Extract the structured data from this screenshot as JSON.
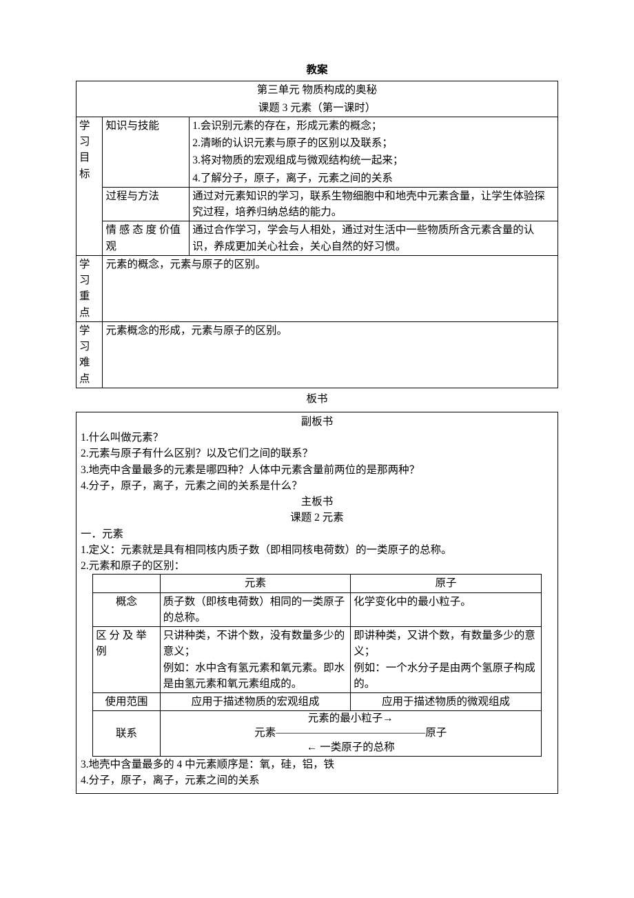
{
  "page_title": "教案",
  "unit_title": "第三单元   物质构成的奥秘",
  "lesson_title": "课题 3 元素（第一课时）",
  "objectives": {
    "row_label": "学 习 目 标",
    "knowledge": {
      "label": "知识与技能",
      "l1": "1.会识别元素的存在，形成元素的概念；",
      "l2": "2.清晰的认识元素与原子的区别以及联系；",
      "l3": "3.将对物质的宏观组成与微观结构统一起来；",
      "l4": "4.了解分子，原子，离子，元素之间的关系"
    },
    "process": {
      "label": "过程与方法",
      "text": "通过对元素知识的学习，联系生物细胞中和地壳中元素含量，让学生体验探究过程，培养归纳总结的能力。"
    },
    "attitude": {
      "label": "情 感 态 度 价值观",
      "text": "通过合作学习，学会与人相处，通过对生活中一些物质所含元素含量的认识，养成更加关心社会，关心自然的好习惯。"
    }
  },
  "keypoint": {
    "label": "学 习 重 点",
    "text": "元素的概念，元素与原子的区别。"
  },
  "difficulty": {
    "label": "学 习 难 点",
    "text": "元素概念的形成，元素与原子的区别。"
  },
  "board": {
    "heading": "板书",
    "sub_heading": "副板书",
    "q1": "1.什么叫做元素？",
    "q2": "2.元素与原子有什么区别？以及它们之间的联系？",
    "q3": "3.地壳中含量最多的元素是哪四种？人体中元素含量前两位的是那两种？",
    "q4": "4.分子，原子，离子，元素之间的关系是什么？",
    "main_heading": "主板书",
    "main_topic": "课题 2 元素",
    "sec1": "一．元素",
    "def": "1.定义：元素就是具有相同核内质子数（即相同核电荷数）的一类原子的总称。",
    "diff_label": "2.元素和原子的区别：",
    "table": {
      "h_element": "元素",
      "h_atom": "原子",
      "r_concept": "概念",
      "r_concept_e": "质子数（即核电荷数）相同的一类原子的总称。",
      "r_concept_a": "化学变化中的最小粒子。",
      "r_diff": "区 分 及 举例",
      "r_diff_e": "只讲种类，不讲个数，没有数量多少的意义；\n例如：水中含有氢元素和氧元素。即水是由氢元素和氧元素组成的。",
      "r_diff_a": "即讲种类，又讲个数，有数量多少的意义；\n例如：一个水分子是由两个氢原子构成的。",
      "r_scope": "使用范围",
      "r_scope_e": "应用于描述物质的宏观组成",
      "r_scope_a": "应用于描述物质的微观组成",
      "r_link": "联系",
      "rel_top": "元素的最小粒子→",
      "rel_mid_left": "元素",
      "rel_mid_right": "原子",
      "rel_bottom": "← 一类原子的总称"
    },
    "note3": "3.地壳中含量最多的 4 中元素顺序是：氧，硅，铝，铁",
    "note4": "4.分子，原子，离子，元素之间的关系"
  }
}
